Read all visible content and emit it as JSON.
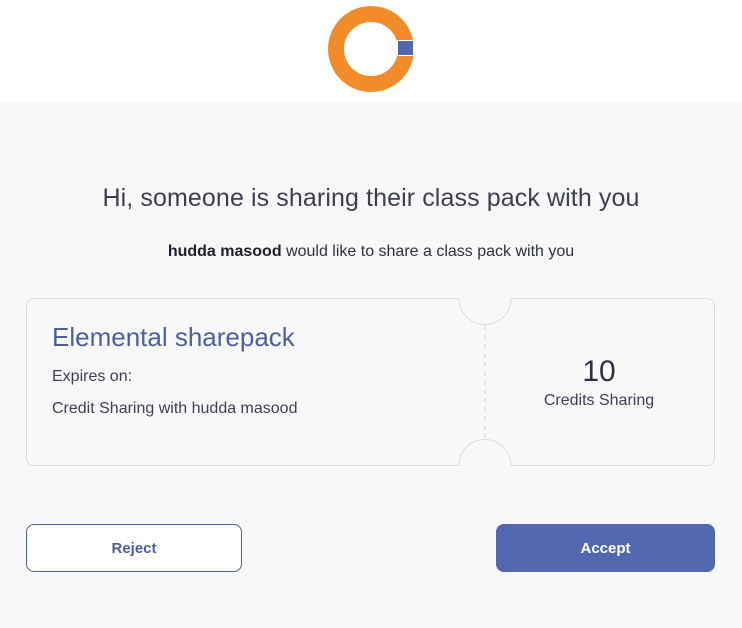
{
  "brand": {
    "logo_icon": "orange-ring-logo",
    "primary_color": "#f28c28",
    "accent_color": "#5168b1"
  },
  "invite": {
    "title": "Hi, someone is sharing their class pack with you",
    "sender_name": "hudda masood",
    "message_suffix": " would like to share a class pack with you"
  },
  "pack": {
    "name": "Elemental sharepack",
    "expires_label": "Expires on:",
    "credit_sharing_text": "Credit Sharing with hudda masood",
    "credits_count": "10",
    "credits_label": "Credits Sharing"
  },
  "actions": {
    "reject_label": "Reject",
    "accept_label": "Accept"
  }
}
